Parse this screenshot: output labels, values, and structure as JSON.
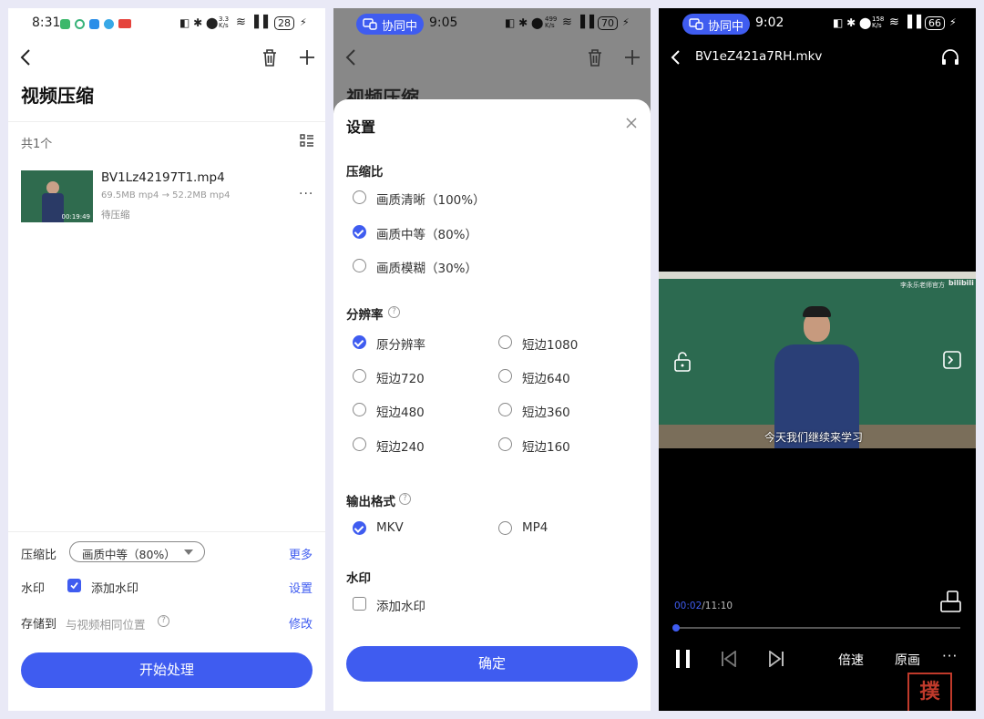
{
  "p1": {
    "status_time": "8:31",
    "status_right": "28",
    "status_speed": "3.3\nK/s",
    "title": "视频压缩",
    "count": "共1个",
    "file": {
      "name": "BV1Lz42197T1.mp4",
      "size": "69.5MB mp4 → 52.2MB mp4",
      "status": "待压缩",
      "duration": "00:19:49"
    },
    "compress_label": "压缩比",
    "compress_value": "画质中等（80%）",
    "more": "更多",
    "watermark_label": "水印",
    "watermark_option": "添加水印",
    "watermark_settings": "设置",
    "save_label": "存储到",
    "save_value": "与视频相同位置",
    "modify": "修改",
    "start": "开始处理"
  },
  "p2": {
    "collab": "协同中",
    "status_time": "9:05",
    "status_right": "70",
    "status_speed": "499\nK/s",
    "bg_title": "视频压缩",
    "sheet_title": "设置",
    "compress_section": "压缩比",
    "compress_options": [
      "画质清晰（100%）",
      "画质中等（80%）",
      "画质模糊（30%）"
    ],
    "compress_selected": 1,
    "resolution_section": "分辨率",
    "resolution_options": [
      "原分辨率",
      "短边1080",
      "短边720",
      "短边640",
      "短边480",
      "短边360",
      "短边240",
      "短边160"
    ],
    "resolution_selected": 0,
    "format_section": "输出格式",
    "format_options": [
      "MKV",
      "MP4"
    ],
    "format_selected": 0,
    "watermark_section": "水印",
    "watermark_option": "添加水印",
    "confirm": "确定"
  },
  "p3": {
    "collab": "协同中",
    "status_time": "9:02",
    "status_right": "66",
    "status_speed": "158\nK/s",
    "file_name": "BV1eZ421a7RH.mkv",
    "subtitle": "今天我们继续来学习",
    "video_watermark": "李永乐老师官方",
    "video_logo": "bilibili",
    "time_current": "00:02",
    "time_total": "/11:10",
    "progress": 0.003,
    "speed_button": "倍速",
    "quality_button": "原画",
    "more": "···"
  },
  "colors": {
    "accent": "#3f5cf0",
    "text": "#222222",
    "muted": "#999999"
  }
}
